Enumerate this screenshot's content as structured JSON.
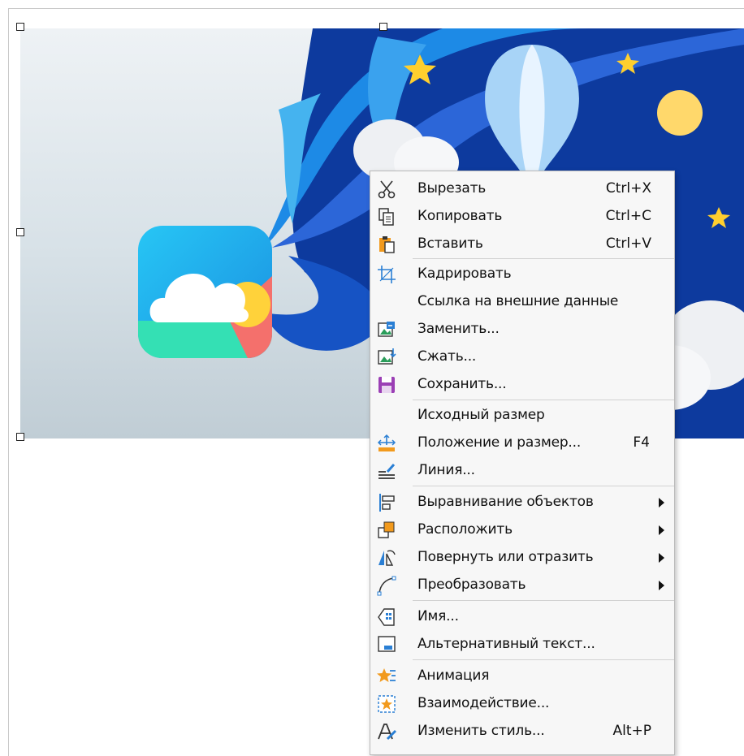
{
  "context_menu": {
    "items": [
      {
        "label": "Вырезать",
        "shortcut": "Ctrl+X",
        "icon": "scissors-icon"
      },
      {
        "label": "Копировать",
        "shortcut": "Ctrl+C",
        "icon": "copy-icon"
      },
      {
        "label": "Вставить",
        "shortcut": "Ctrl+V",
        "icon": "paste-icon"
      },
      {
        "label": "Кадрировать",
        "shortcut": "",
        "icon": "crop-icon"
      },
      {
        "label": "Ссылка на внешние данные",
        "shortcut": "",
        "icon": ""
      },
      {
        "label": "Заменить...",
        "shortcut": "",
        "icon": "replace-image-icon"
      },
      {
        "label": "Сжать...",
        "shortcut": "",
        "icon": "compress-image-icon"
      },
      {
        "label": "Сохранить...",
        "shortcut": "",
        "icon": "save-icon"
      },
      {
        "label": "Исходный размер",
        "shortcut": "",
        "icon": ""
      },
      {
        "label": "Положение и размер...",
        "shortcut": "F4",
        "icon": "position-size-icon"
      },
      {
        "label": "Линия...",
        "shortcut": "",
        "icon": "line-icon"
      },
      {
        "label": "Выравнивание объектов",
        "shortcut": "",
        "icon": "align-objects-icon",
        "submenu": true
      },
      {
        "label": "Расположить",
        "shortcut": "",
        "icon": "arrange-icon",
        "submenu": true
      },
      {
        "label": "Повернуть или отразить",
        "shortcut": "",
        "icon": "rotate-flip-icon",
        "submenu": true
      },
      {
        "label": "Преобразовать",
        "shortcut": "",
        "icon": "convert-icon",
        "submenu": true
      },
      {
        "label": "Имя...",
        "shortcut": "",
        "icon": "name-icon"
      },
      {
        "label": "Альтернативный текст...",
        "shortcut": "",
        "icon": "alt-text-icon"
      },
      {
        "label": "Анимация",
        "shortcut": "",
        "icon": "animation-icon"
      },
      {
        "label": "Взаимодействие...",
        "shortcut": "",
        "icon": "interaction-icon"
      },
      {
        "label": "Изменить стиль...",
        "shortcut": "Alt+P",
        "icon": "edit-style-icon"
      }
    ]
  },
  "colors": {
    "menu_bg": "#f7f7f7",
    "wave_blue": "#1a73e8",
    "night_blue": "#0d3a9e",
    "star_yellow": "#ffcf2e",
    "icon_blue": "#2a7fd4",
    "icon_orange": "#f29a1d",
    "icon_purple": "#9b3fb5"
  }
}
